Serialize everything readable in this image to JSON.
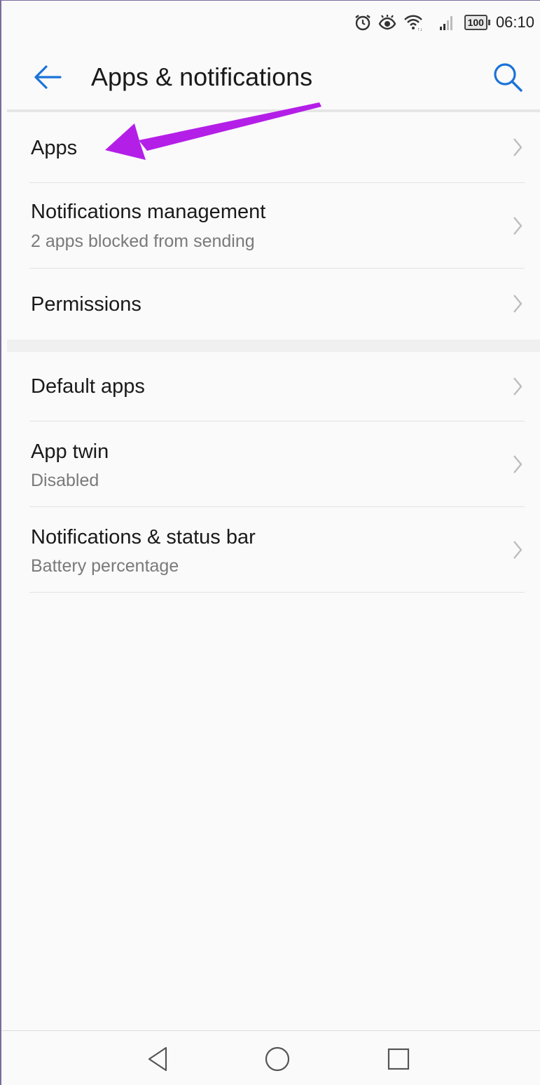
{
  "status_bar": {
    "icons": [
      "alarm-icon",
      "eye-comfort-icon",
      "wifi-icon",
      "signal-icon"
    ],
    "battery": "100",
    "time": "06:10"
  },
  "app_bar": {
    "back_icon": "arrow-left-icon",
    "title": "Apps & notifications",
    "search_icon": "search-icon",
    "accent_color": "#1a73d9"
  },
  "sections": [
    {
      "items": [
        {
          "title": "Apps",
          "subtitle": ""
        },
        {
          "title": "Notifications management",
          "subtitle": "2 apps blocked from sending"
        },
        {
          "title": "Permissions",
          "subtitle": ""
        }
      ]
    },
    {
      "items": [
        {
          "title": "Default apps",
          "subtitle": ""
        },
        {
          "title": "App twin",
          "subtitle": "Disabled"
        },
        {
          "title": "Notifications & status bar",
          "subtitle": "Battery percentage"
        }
      ]
    }
  ],
  "annotation": {
    "color": "#b41fe8",
    "points_to": "Apps"
  },
  "nav_bar": {
    "icons": [
      "nav-back-icon",
      "nav-home-icon",
      "nav-recents-icon"
    ]
  }
}
